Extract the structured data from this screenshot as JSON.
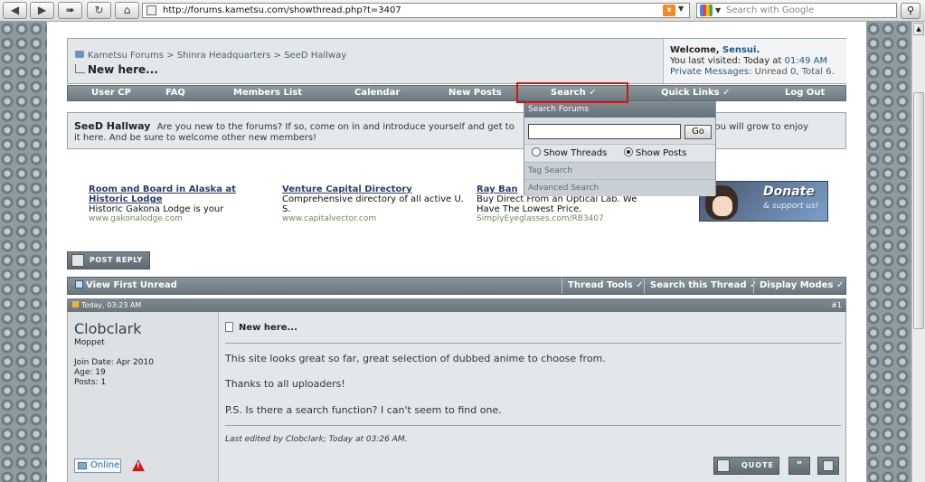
{
  "browser": {
    "url": "http://forums.kametsu.com/showthread.php?t=3407",
    "search_placeholder": "Search with Google",
    "nav_icons": [
      "back-icon",
      "forward-icon",
      "fast-forward-icon",
      "reload-icon",
      "home-icon"
    ]
  },
  "breadcrumb": {
    "items": [
      "Kametsu Forums",
      "Shinra Headquarters",
      "SeeD Hallway"
    ],
    "separator": ">",
    "title": "New here..."
  },
  "welcome": {
    "label": "Welcome,",
    "name": "Sensui",
    "period": ".",
    "last_visit_prefix": "You last visited: Today at",
    "last_visit_time": "01:49 AM",
    "pm_label": "Private Messages:",
    "pm_value": "Unread 0, Total 6."
  },
  "navbar": {
    "items": [
      "User CP",
      "FAQ",
      "Members List",
      "Calendar",
      "New Posts",
      "Search",
      "Quick Links",
      "Log Out"
    ]
  },
  "search_dropdown": {
    "header": "Search Forums",
    "input_value": "",
    "go": "Go",
    "option_threads": "Show Threads",
    "option_posts": "Show Posts",
    "selected": "Show Posts",
    "tag_search": "Tag Search",
    "advanced_search": "Advanced Search"
  },
  "forum": {
    "title": "SeeD Hallway",
    "desc_part1": "Are you new to the forums? If so, come on in and introduce yourself and get to",
    "desc_part2": "ure you will grow to enjoy",
    "desc_line2": "it here. And be sure to welcome other new members!"
  },
  "ads": [
    {
      "title_l1": "Room and Board in Alaska at",
      "title_l2": "Historic Lodge",
      "text": "Historic Gakona Lodge is your",
      "url": "www.gakonalodge.com"
    },
    {
      "title_l1": "Venture Capital Directory",
      "title_l2": "",
      "text": "Comprehensive directory of all active U.",
      "text2": "S.",
      "url": "www.capitalvector.com"
    },
    {
      "title_l1": "Ray Ban",
      "title_l2": "",
      "text": "Buy Direct From an Optical Lab. We",
      "text2": "Have The Lowest Price.",
      "url": "SimplyEyeglasses.com/RB3407"
    }
  ],
  "donate": {
    "title": "Donate",
    "subtitle": "& support us!"
  },
  "post_reply": "POST REPLY",
  "thread_bar": {
    "view_first_unread": "View First Unread",
    "thread_tools": "Thread Tools",
    "search_thread": "Search this Thread",
    "display_modes": "Display Modes"
  },
  "post": {
    "date": "Today, 03:23 AM",
    "number": "#1",
    "username": "Clobclark",
    "rank": "Moppet",
    "join_date": "Join Date: Apr 2010",
    "age": "Age: 19",
    "posts": "Posts: 1",
    "title": "New here...",
    "lines": [
      "This site looks great so far, great selection of dubbed anime to choose from.",
      "Thanks to all uploaders!",
      "P.S. Is there a search function? I can't seem to find one."
    ],
    "edited": "Last edited by Clobclark; Today at 03:26 AM.",
    "online": "Online",
    "quote": "QUOTE"
  },
  "colors": {
    "highlight_box": "#d61414",
    "navbar": "#7a868d",
    "link": "#1b5b86"
  }
}
